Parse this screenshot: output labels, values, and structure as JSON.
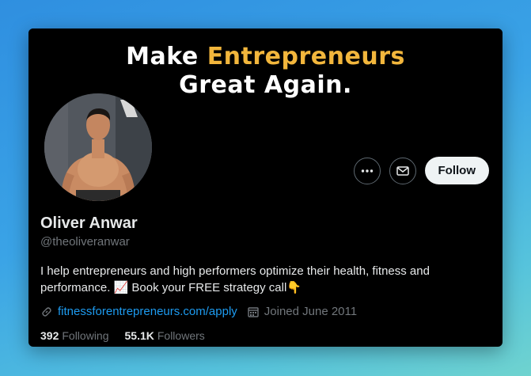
{
  "banner": {
    "line1_prefix": "Make",
    "line1_accent": "Entrepreneurs",
    "line2": "Great Again."
  },
  "profile": {
    "name": "Oliver Anwar",
    "handle": "@theoliveranwar",
    "bio_line1": "I help entrepreneurs and high performers optimize their health, fitness and",
    "bio_line2_a": "performance.",
    "bio_emoji_chart": "📈",
    "bio_line2_b": "Book your FREE strategy call",
    "bio_emoji_point": "👇",
    "link": "fitnessforentrepreneurs.com/apply",
    "joined": "Joined June 2011"
  },
  "stats": {
    "following_count": "392",
    "following_label": "Following",
    "followers_count": "55.1K",
    "followers_label": "Followers"
  },
  "actions": {
    "follow_label": "Follow"
  },
  "icons": {
    "more": "more-icon",
    "mail": "mail-icon",
    "link": "link-icon",
    "calendar": "calendar-icon"
  },
  "colors": {
    "accent_yellow": "#f2b63c",
    "link_blue": "#1d9bf0",
    "muted_gray": "#71767b"
  }
}
